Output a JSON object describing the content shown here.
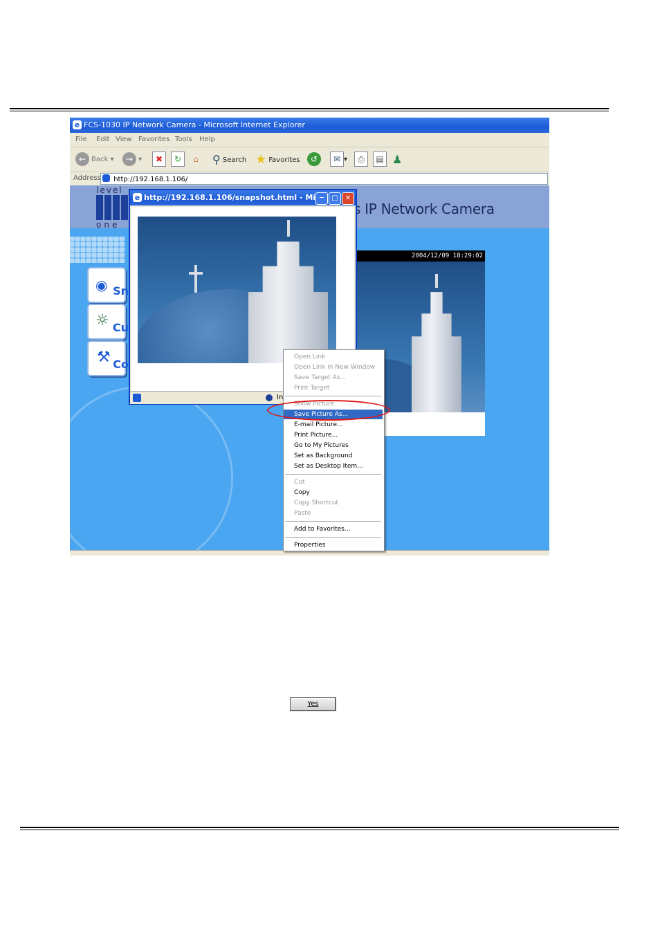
{
  "browser": {
    "title": "FCS-1030 IP Network Camera - Microsoft Internet Explorer",
    "menu": [
      "File",
      "Edit",
      "View",
      "Favorites",
      "Tools",
      "Help"
    ],
    "toolbar": {
      "back": "Back",
      "search": "Search",
      "favorites": "Favorites"
    },
    "address_label": "Address",
    "address": "http://192.168.1.106/"
  },
  "page": {
    "logo_top": "level",
    "logo_bottom": "one",
    "banner_title": "s IP Network Camera",
    "nav": [
      "Sn",
      "Cu",
      "Co"
    ],
    "timestamp": "2004/12/09 18:29:02"
  },
  "popup": {
    "title": "http://192.168.1.106/snapshot.html - Mic...",
    "status_text": "In"
  },
  "context_menu": {
    "groups": [
      [
        {
          "label": "Open Link",
          "enabled": false
        },
        {
          "label": "Open Link in New Window",
          "enabled": false
        },
        {
          "label": "Save Target As...",
          "enabled": false
        },
        {
          "label": "Print Target",
          "enabled": false
        }
      ],
      [
        {
          "label": "Show Picture",
          "enabled": false
        },
        {
          "label": "Save Picture As...",
          "enabled": true,
          "selected": true
        },
        {
          "label": "E-mail Picture...",
          "enabled": true
        },
        {
          "label": "Print Picture...",
          "enabled": true
        },
        {
          "label": "Go to My Pictures",
          "enabled": true
        },
        {
          "label": "Set as Background",
          "enabled": true
        },
        {
          "label": "Set as Desktop Item...",
          "enabled": true
        }
      ],
      [
        {
          "label": "Cut",
          "enabled": false
        },
        {
          "label": "Copy",
          "enabled": true
        },
        {
          "label": "Copy Shortcut",
          "enabled": false
        },
        {
          "label": "Paste",
          "enabled": false
        }
      ],
      [
        {
          "label": "Add to Favorites...",
          "enabled": true
        }
      ],
      [
        {
          "label": "Properties",
          "enabled": true
        }
      ]
    ]
  },
  "dialog": {
    "yes_label": "Yes"
  },
  "colors": {
    "highlight": "#316ac5",
    "annotation": "#e01818",
    "page_bg": "#4aa6f0"
  }
}
